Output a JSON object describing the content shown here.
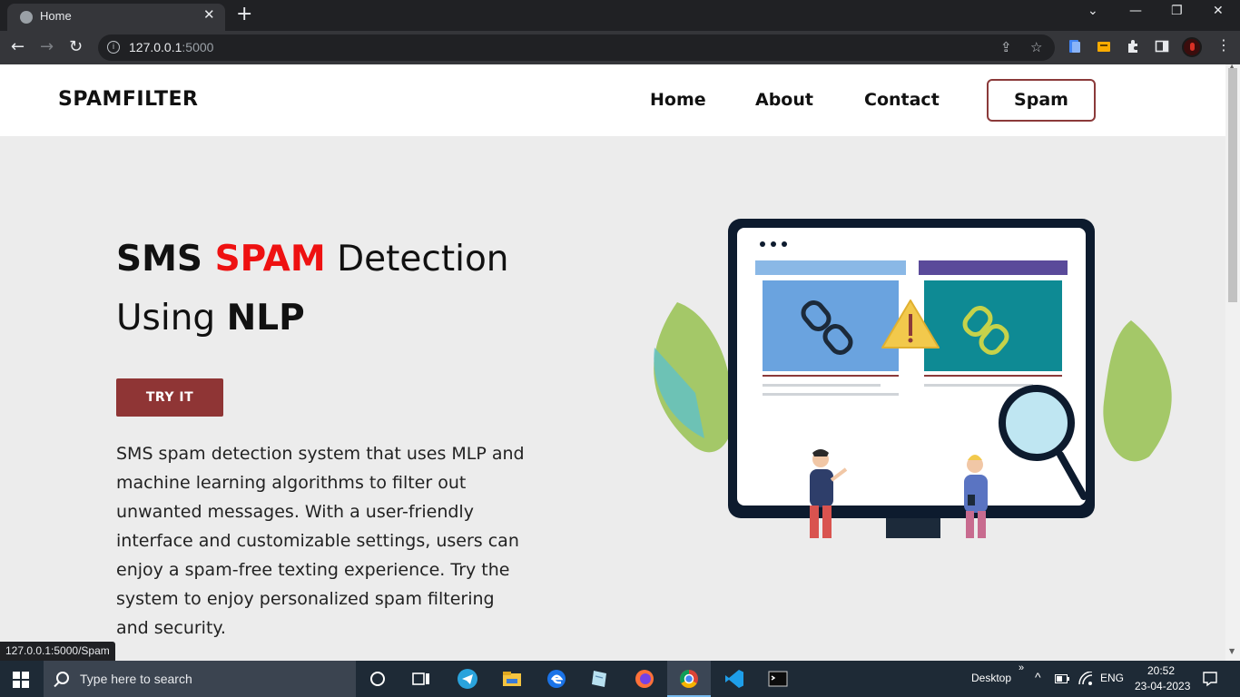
{
  "browser": {
    "tab_title": "Home",
    "url_host": "127.0.0.1",
    "url_port": ":5000",
    "status_url": "127.0.0.1:5000/Spam"
  },
  "site": {
    "brand": "SPAMFILTER",
    "nav": [
      "Home",
      "About",
      "Contact"
    ],
    "nav_button": "Spam"
  },
  "hero": {
    "title_part1": "SMS ",
    "title_highlight": "SPAM",
    "title_part2": " Detection",
    "title_line2_prefix": "Using ",
    "title_line2_bold": "NLP",
    "cta": "TRY IT",
    "description": "SMS spam detection system that uses MLP and machine learning algorithms to filter out unwanted messages. With a user-friendly interface and customizable settings, users can enjoy a spam-free texting experience. Try the system to enjoy personalized spam filtering and security."
  },
  "taskbar": {
    "search_placeholder": "Type here to search",
    "desktop_label": "Desktop",
    "language": "ENG",
    "time": "20:52",
    "date": "23-04-2023"
  },
  "colors": {
    "accent_red": "#ee1111",
    "button_maroon": "#8f3535"
  }
}
